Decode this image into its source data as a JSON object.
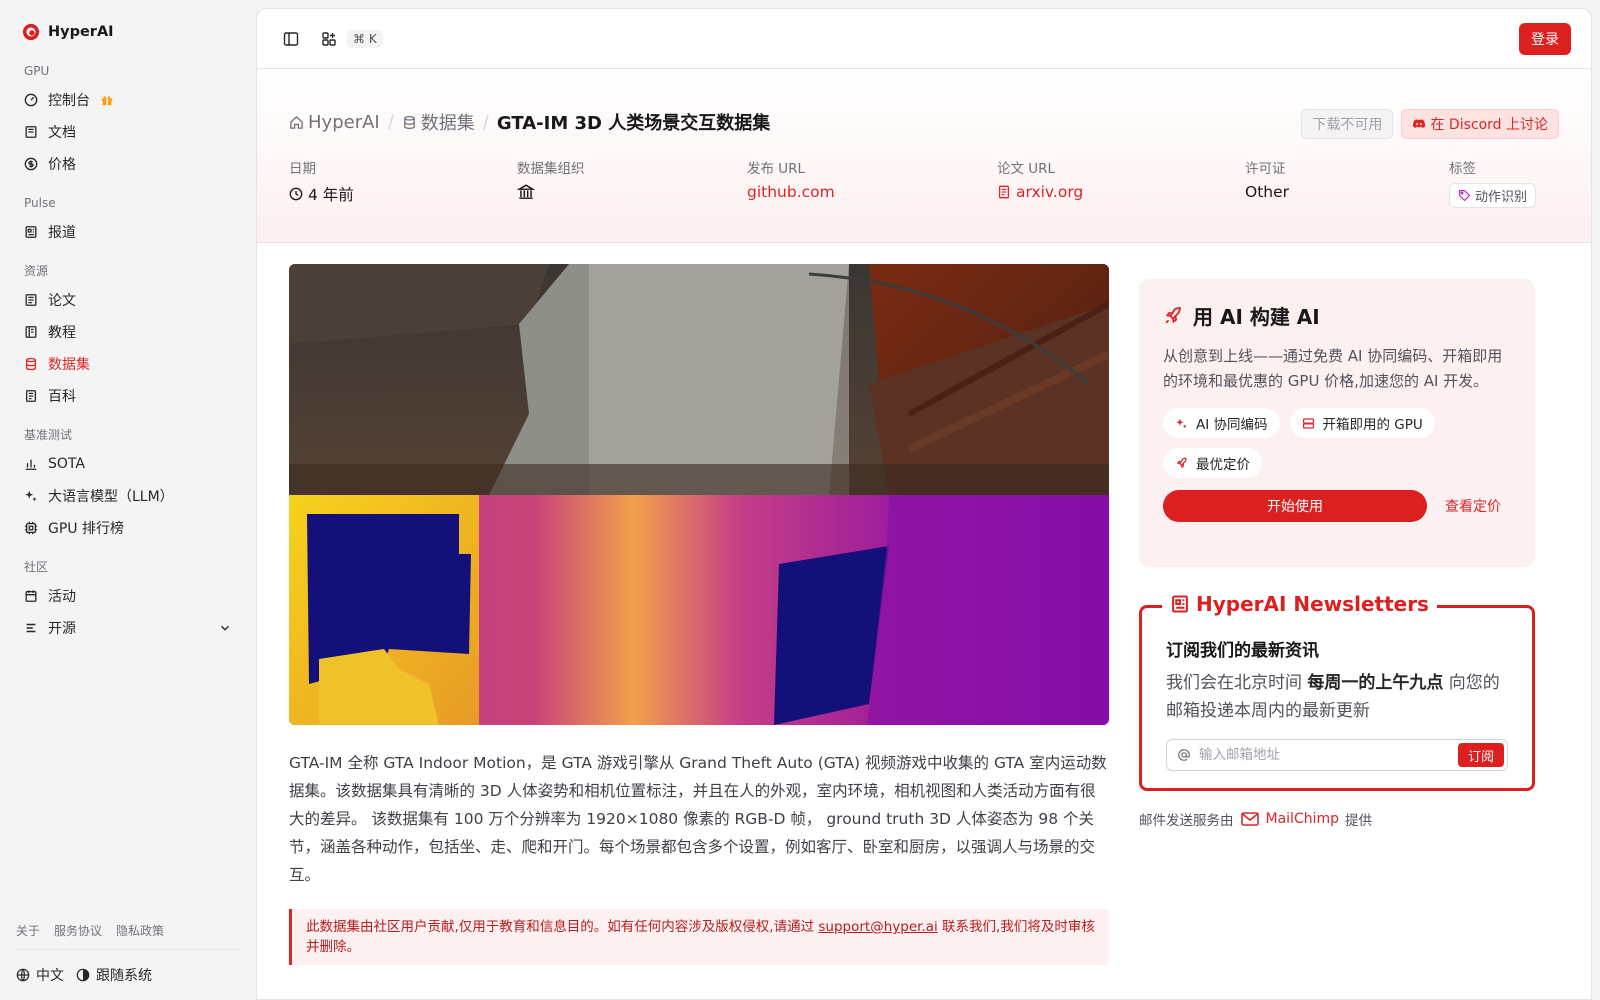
{
  "sidebar": {
    "brand": "HyperAI",
    "groups": [
      {
        "label": "GPU",
        "items": [
          {
            "label": "控制台",
            "icon": "gauge-icon"
          },
          {
            "label": "文档",
            "icon": "book-icon"
          },
          {
            "label": "价格",
            "icon": "dollar-icon"
          }
        ]
      },
      {
        "label": "Pulse",
        "items": [
          {
            "label": "报道",
            "icon": "newspaper-icon"
          }
        ]
      },
      {
        "label": "资源",
        "items": [
          {
            "label": "论文",
            "icon": "paper-icon"
          },
          {
            "label": "教程",
            "icon": "tutorial-icon"
          },
          {
            "label": "数据集",
            "icon": "database-icon"
          },
          {
            "label": "百科",
            "icon": "wiki-icon"
          }
        ]
      },
      {
        "label": "基准测试",
        "items": [
          {
            "label": "SOTA",
            "icon": "chart-icon"
          },
          {
            "label": "大语言模型（LLM）",
            "icon": "sparkles-icon"
          },
          {
            "label": "GPU 排行榜",
            "icon": "cpu-icon"
          }
        ]
      },
      {
        "label": "社区",
        "items": [
          {
            "label": "活动",
            "icon": "calendar-icon"
          },
          {
            "label": "开源",
            "icon": "list-icon"
          }
        ]
      }
    ],
    "footer_links": [
      "关于",
      "服务协议",
      "隐私政策"
    ],
    "language": "中文",
    "theme": "跟随系统"
  },
  "topbar": {
    "shortcut": "⌘ K",
    "login": "登录"
  },
  "breadcrumb": {
    "home": "HyperAI",
    "section": "数据集",
    "current": "GTA-IM 3D 人类场景交互数据集"
  },
  "hero_actions": {
    "download": "下载不可用",
    "discord": "在 Discord 上讨论"
  },
  "meta": {
    "date_label": "日期",
    "date_value": "4 年前",
    "org_label": "数据集组织",
    "release_label": "发布 URL",
    "release_value": "github.com",
    "paper_label": "论文 URL",
    "paper_value": "arxiv.org",
    "license_label": "许可证",
    "license_value": "Other",
    "tags_label": "标签",
    "tag_value": "动作识别"
  },
  "description": "GTA-IM 全称 GTA Indoor Motion，是 GTA 游戏引擎从 Grand Theft Auto (GTA) 视频游戏中收集的 GTA 室内运动数据集。该数据集具有清晰的 3D 人体姿势和相机位置标注，并且在人的外观，室内环境，相机视图和人类活动方面有很大的差异。 该数据集有 100 万个分辨率为 1920×1080 像素的 RGB-D 帧， ground truth 3D 人体姿态为 98 个关节，涵盖各种动作，包括坐、走、爬和开门。每个场景都包含多个设置，例如客厅、卧室和厨房，以强调人与场景的交互。",
  "notice": {
    "before": "此数据集由社区用户贡献,仅用于教育和信息目的。如有任何内容涉及版权侵权,请通过 ",
    "email": "support@hyper.ai",
    "after": " 联系我们,我们将及时审核并删除。"
  },
  "promo": {
    "title": "用 AI 构建 AI",
    "text": "从创意到上线——通过免费 AI 协同编码、开箱即用的环境和最优惠的 GPU 价格,加速您的 AI 开发。",
    "chips": [
      "AI 协同编码",
      "开箱即用的 GPU",
      "最优定价"
    ],
    "start": "开始使用",
    "pricing": "查看定价"
  },
  "newsletter": {
    "title": "HyperAI Newsletters",
    "heading": "订阅我们的最新资讯",
    "text_before": "我们会在北京时间 ",
    "text_bold": "每周一的上午九点",
    "text_after": " 向您的邮箱投递本周内的最新更新",
    "placeholder": "输入邮箱地址",
    "subscribe": "订阅",
    "provider_before": "邮件发送服务由",
    "provider": "MailChimp",
    "provider_after": "提供"
  },
  "colors": {
    "accent": "#dc1f1f",
    "accent_soft": "#fdf0f0"
  }
}
